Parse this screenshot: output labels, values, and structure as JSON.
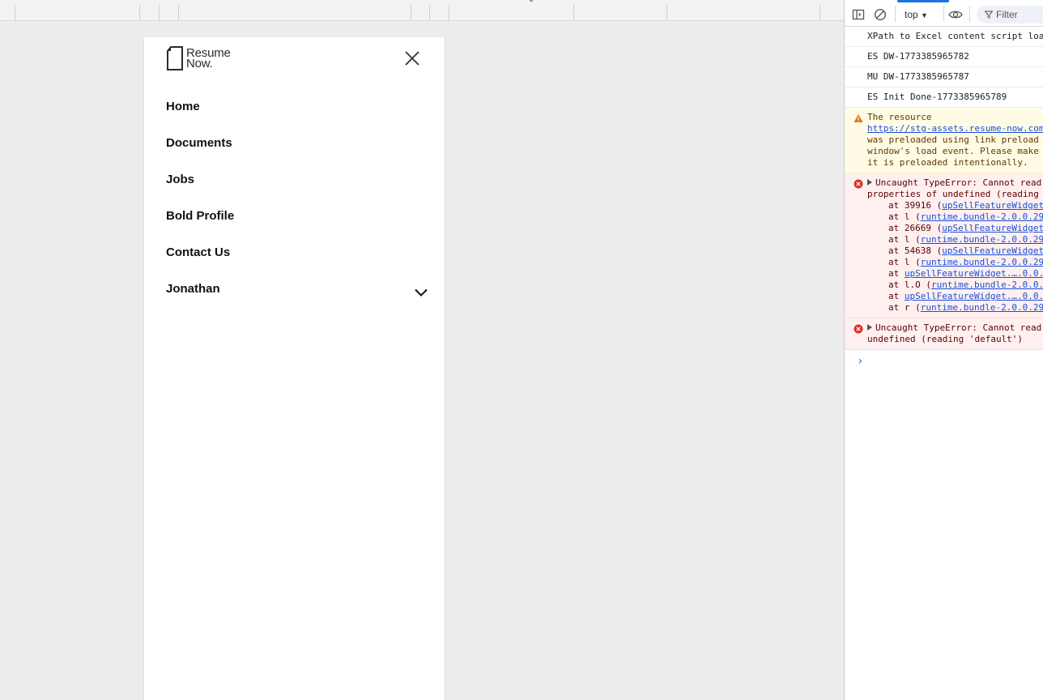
{
  "site": {
    "logo_line1": "Resume",
    "logo_line2": "Now.",
    "nav_items": [
      "Home",
      "Documents",
      "Jobs",
      "Bold Profile",
      "Contact Us",
      "Jonathan"
    ]
  },
  "devtools": {
    "context": "top",
    "filter_placeholder": "Filter",
    "logs": [
      {
        "type": "info",
        "lines": [
          "XPath to Excel content script loa"
        ]
      },
      {
        "type": "info",
        "lines": [
          "ES DW-1773385965782"
        ]
      },
      {
        "type": "info",
        "lines": [
          "MU DW-1773385965787"
        ]
      },
      {
        "type": "info",
        "lines": [
          "ES Init Done-1773385965789"
        ]
      }
    ],
    "warning": {
      "line1": "The resource",
      "link": "https://stg-assets.resume-now.com",
      "line3": "was preloaded using link preload",
      "line4": "window's load event. Please make",
      "line5": "it is preloaded intentionally."
    },
    "error1": {
      "head1": "Uncaught TypeError: Cannot read",
      "head2": "properties of undefined (reading",
      "stack": [
        {
          "pre": "at 39916 (",
          "link": "upSellFeatureWidget"
        },
        {
          "pre": "at l (",
          "link": "runtime.bundle-2.0.0.29"
        },
        {
          "pre": "at 26669 (",
          "link": "upSellFeatureWidget"
        },
        {
          "pre": "at l (",
          "link": "runtime.bundle-2.0.0.29"
        },
        {
          "pre": "at 54638 (",
          "link": "upSellFeatureWidget"
        },
        {
          "pre": "at l (",
          "link": "runtime.bundle-2.0.0.29"
        },
        {
          "pre": "at ",
          "link": "upSellFeatureWidget.….0.0."
        },
        {
          "pre": "at l.O (",
          "link": "runtime.bundle-2.0.0."
        },
        {
          "pre": "at ",
          "link": "upSellFeatureWidget.….0.0."
        },
        {
          "pre": "at r (",
          "link": "runtime.bundle-2.0.0.29"
        }
      ]
    },
    "error2": {
      "head1": "Uncaught TypeError: Cannot read",
      "head2": "undefined (reading 'default')"
    },
    "prompt": "›"
  },
  "colors": {
    "accent": "#1a73e8",
    "error_bg": "#fff0f0",
    "warning_bg": "#fffbe5"
  }
}
